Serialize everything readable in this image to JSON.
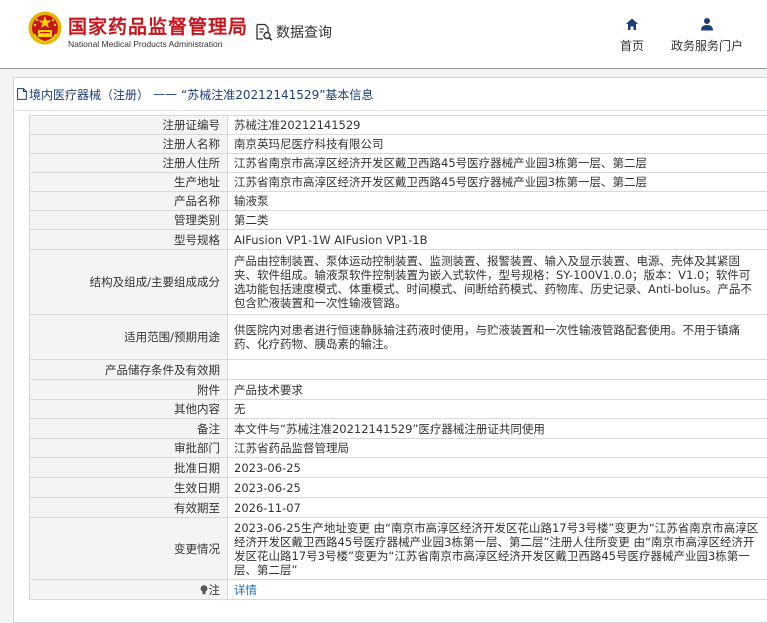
{
  "header": {
    "brand_cn": "国家药品监督管理局",
    "brand_en": "National Medical Products Administration",
    "query_label": "数据查询",
    "nav": {
      "home": "首页",
      "portal": "政务服务门户"
    }
  },
  "breadcrumb": {
    "section": "境内医疗器械（注册）",
    "separator": "——",
    "record": "“苏械注准20212141529”基本信息"
  },
  "rows": [
    {
      "label": "注册证编号",
      "value": "苏械注准20212141529"
    },
    {
      "label": "注册人名称",
      "value": "南京英玛尼医疗科技有限公司"
    },
    {
      "label": "注册人住所",
      "value": "江苏省南京市高淳区经济开发区戴卫西路45号医疗器械产业园3栋第一层、第二层"
    },
    {
      "label": "生产地址",
      "value": "江苏省南京市高淳区经济开发区戴卫西路45号医疗器械产业园3栋第一层、第二层"
    },
    {
      "label": "产品名称",
      "value": "输液泵"
    },
    {
      "label": "管理类别",
      "value": "第二类"
    },
    {
      "label": "型号规格",
      "value": "AIFusion VP1-1W AIFusion VP1-1B"
    },
    {
      "label": "结构及组成/主要组成成分",
      "value": "产品由控制装置、泵体运动控制装置、监测装置、报警装置、输入及显示装置、电源、壳体及其紧固夹、软件组成。输液泵软件控制装置为嵌入式软件，型号规格：SY-100V1.0.0；版本：V1.0；软件可选功能包括速度模式、体重模式、时间模式、间断给药模式、药物库、历史记录、Anti-bolus。产品不包含贮液装置和一次性输液管路。"
    },
    {
      "label": "适用范围/预期用途",
      "value": "供医院内对患者进行恒速静脉输注药液时使用，与贮液装置和一次性输液管路配套使用。不用于镇痛药、化疗药物、胰岛素的输注。"
    },
    {
      "label": "产品储存条件及有效期",
      "value": ""
    },
    {
      "label": "附件",
      "value": "产品技术要求"
    },
    {
      "label": "其他内容",
      "value": "无"
    },
    {
      "label": "备注",
      "value": "本文件与“苏械注准20212141529”医疗器械注册证共同使用"
    },
    {
      "label": "审批部门",
      "value": "江苏省药品监督管理局"
    },
    {
      "label": "批准日期",
      "value": "2023-06-25"
    },
    {
      "label": "生效日期",
      "value": "2023-06-25"
    },
    {
      "label": "有效期至",
      "value": "2026-11-07"
    },
    {
      "label": "变更情况",
      "value": "2023-06-25生产地址变更 由“南京市高淳区经济开发区花山路17号3号楼”变更为“江苏省南京市高淳区经济开发区戴卫西路45号医疗器械产业园3栋第一层、第二层”注册人住所变更 由“南京市高淳区经济开发区花山路17号3号楼”变更为“江苏省南京市高淳区经济开发区戴卫西路45号医疗器械产业园3栋第一层、第二层”"
    }
  ],
  "note_row": {
    "label": "注",
    "value": "详情"
  },
  "colors": {
    "brand_red": "#c8161d",
    "nav_blue": "#1a3f78",
    "link_blue": "#1b6ec2",
    "emblem_gold": "#e8b400"
  }
}
